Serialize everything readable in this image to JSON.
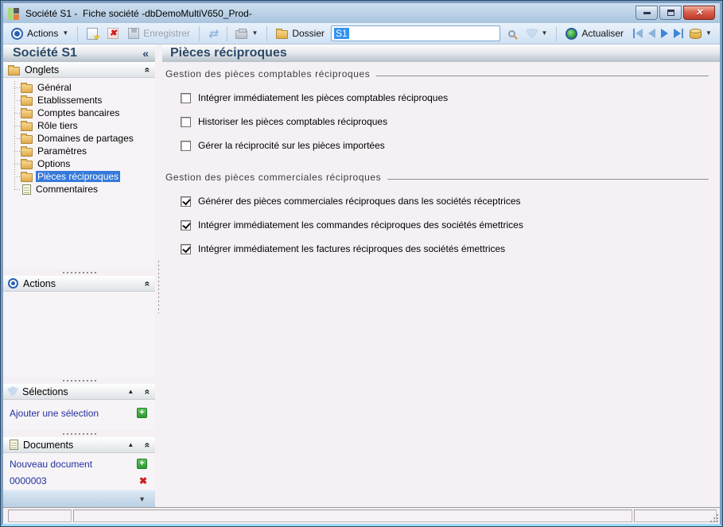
{
  "window": {
    "title": "Société S1 -  Fiche société -dbDemoMultiV650_Prod-"
  },
  "toolbar": {
    "actions_label": "Actions",
    "enregistrer_label": "Enregistrer",
    "dossier_label": "Dossier",
    "search_value": "S1",
    "actualiser_label": "Actualiser"
  },
  "sidebar": {
    "title": "Société S1",
    "collapse_glyph": "«",
    "panels": {
      "onglets": {
        "label": "Onglets"
      },
      "actions": {
        "label": "Actions"
      },
      "selections": {
        "label": "Sélections",
        "add_link": "Ajouter une sélection"
      },
      "documents": {
        "label": "Documents",
        "new_link": "Nouveau document",
        "doc_number": "0000003"
      }
    },
    "tree": [
      {
        "label": "Général",
        "icon": "folder",
        "selected": false
      },
      {
        "label": "Etablissements",
        "icon": "folder",
        "selected": false
      },
      {
        "label": "Comptes bancaires",
        "icon": "folder",
        "selected": false
      },
      {
        "label": "Rôle tiers",
        "icon": "folder",
        "selected": false
      },
      {
        "label": "Domaines de partages",
        "icon": "folder",
        "selected": false
      },
      {
        "label": "Paramètres",
        "icon": "folder",
        "selected": false
      },
      {
        "label": "Options",
        "icon": "folder",
        "selected": false
      },
      {
        "label": "Pièces réciproques",
        "icon": "folder-open",
        "selected": true
      },
      {
        "label": "Commentaires",
        "icon": "document",
        "selected": false
      }
    ]
  },
  "main": {
    "title": "Pièces réciproques",
    "groups": [
      {
        "title": "Gestion des pièces comptables réciproques",
        "checkboxes": [
          {
            "label": "Intégrer immédiatement les pièces comptables réciproques",
            "checked": false
          },
          {
            "label": "Historiser les pièces comptables réciproques",
            "checked": false
          },
          {
            "label": "Gérer la réciprocité sur les pièces importées",
            "checked": false
          }
        ]
      },
      {
        "title": "Gestion des pièces commerciales réciproques",
        "checkboxes": [
          {
            "label": "Générer des pièces commerciales réciproques dans les sociétés réceptrices",
            "checked": true
          },
          {
            "label": "Intégrer immédiatement les commandes réciproques des sociétés émettrices",
            "checked": true
          },
          {
            "label": "Intégrer immédiatement les factures réciproques des sociétés émettrices",
            "checked": true
          }
        ]
      }
    ]
  },
  "colors": {
    "selection_blue": "#3579db",
    "link_navy": "#23309c",
    "header_text": "#2c4a68",
    "add_green": "#2f9a32",
    "delete_red": "#cc2020",
    "titlebar_blue": "#a9c4de"
  }
}
